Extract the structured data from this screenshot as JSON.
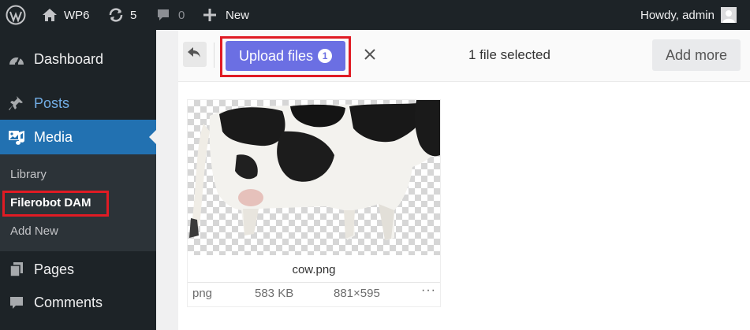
{
  "adminbar": {
    "site_name": "WP6",
    "updates_count": "5",
    "comments_count": "0",
    "new_label": "New",
    "greeting": "Howdy, admin"
  },
  "sidebar": {
    "items": [
      {
        "label": "Dashboard",
        "icon": "dashboard-icon"
      },
      {
        "label": "Posts",
        "icon": "pin-icon"
      },
      {
        "label": "Media",
        "icon": "media-icon"
      },
      {
        "label": "Pages",
        "icon": "pages-icon"
      },
      {
        "label": "Comments",
        "icon": "comments-icon"
      }
    ],
    "submenu": [
      {
        "label": "Library"
      },
      {
        "label": "Filerobot DAM"
      },
      {
        "label": "Add New"
      }
    ]
  },
  "uploader": {
    "upload_label": "Upload files",
    "upload_count": "1",
    "status_text": "1 file selected",
    "add_more_label": "Add more",
    "file": {
      "name": "cow.png",
      "type": "png",
      "size": "583 KB",
      "dimensions": "881×595",
      "more_label": "···"
    }
  },
  "colors": {
    "adminbar_bg": "#1d2327",
    "menu_active": "#2271b1",
    "upload_button": "#6b6fe3",
    "highlight_box": "#e01b24"
  }
}
